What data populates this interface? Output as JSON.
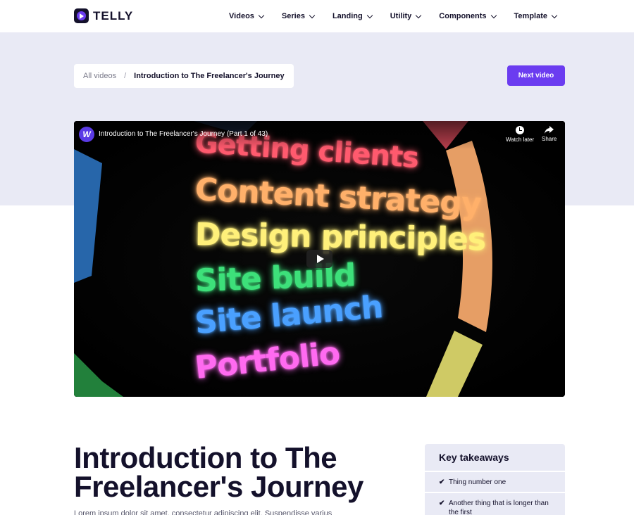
{
  "brand": {
    "name": "TELLY",
    "accent": "#6b3cf0",
    "dark": "#14112b",
    "band": "#e9eaf5"
  },
  "nav": [
    {
      "label": "Videos"
    },
    {
      "label": "Series"
    },
    {
      "label": "Landing"
    },
    {
      "label": "Utility"
    },
    {
      "label": "Components"
    },
    {
      "label": "Template"
    }
  ],
  "breadcrumb": {
    "parent": "All videos",
    "separator": "/",
    "current": "Introduction to The Freelancer's Journey"
  },
  "next_button": "Next video",
  "video": {
    "channel_initial": "W",
    "title": "Introduction to The Freelancer's Journey (Part 1 of 43)",
    "watch_later": "Watch later",
    "share": "Share",
    "thumbnail_lines": [
      {
        "text": "Getting clients",
        "color": "#ff5a6e"
      },
      {
        "text": "Content strategy",
        "color": "#ffb06a"
      },
      {
        "text": "Design principles",
        "color": "#fff07a"
      },
      {
        "text": "Site build",
        "color": "#3de07a"
      },
      {
        "text": "Site launch",
        "color": "#4aa0ff"
      },
      {
        "text": "Portfolio",
        "color": "#ff6af0"
      }
    ]
  },
  "page_title": "Introduction to The Freelancer's Journey",
  "intro_text": "Lorem ipsum dolor sit amet, consectetur adipiscing elit. Suspendisse varius",
  "takeaways": {
    "heading": "Key takeaways",
    "items": [
      "Thing number one",
      "Another thing that is longer than the first"
    ]
  }
}
